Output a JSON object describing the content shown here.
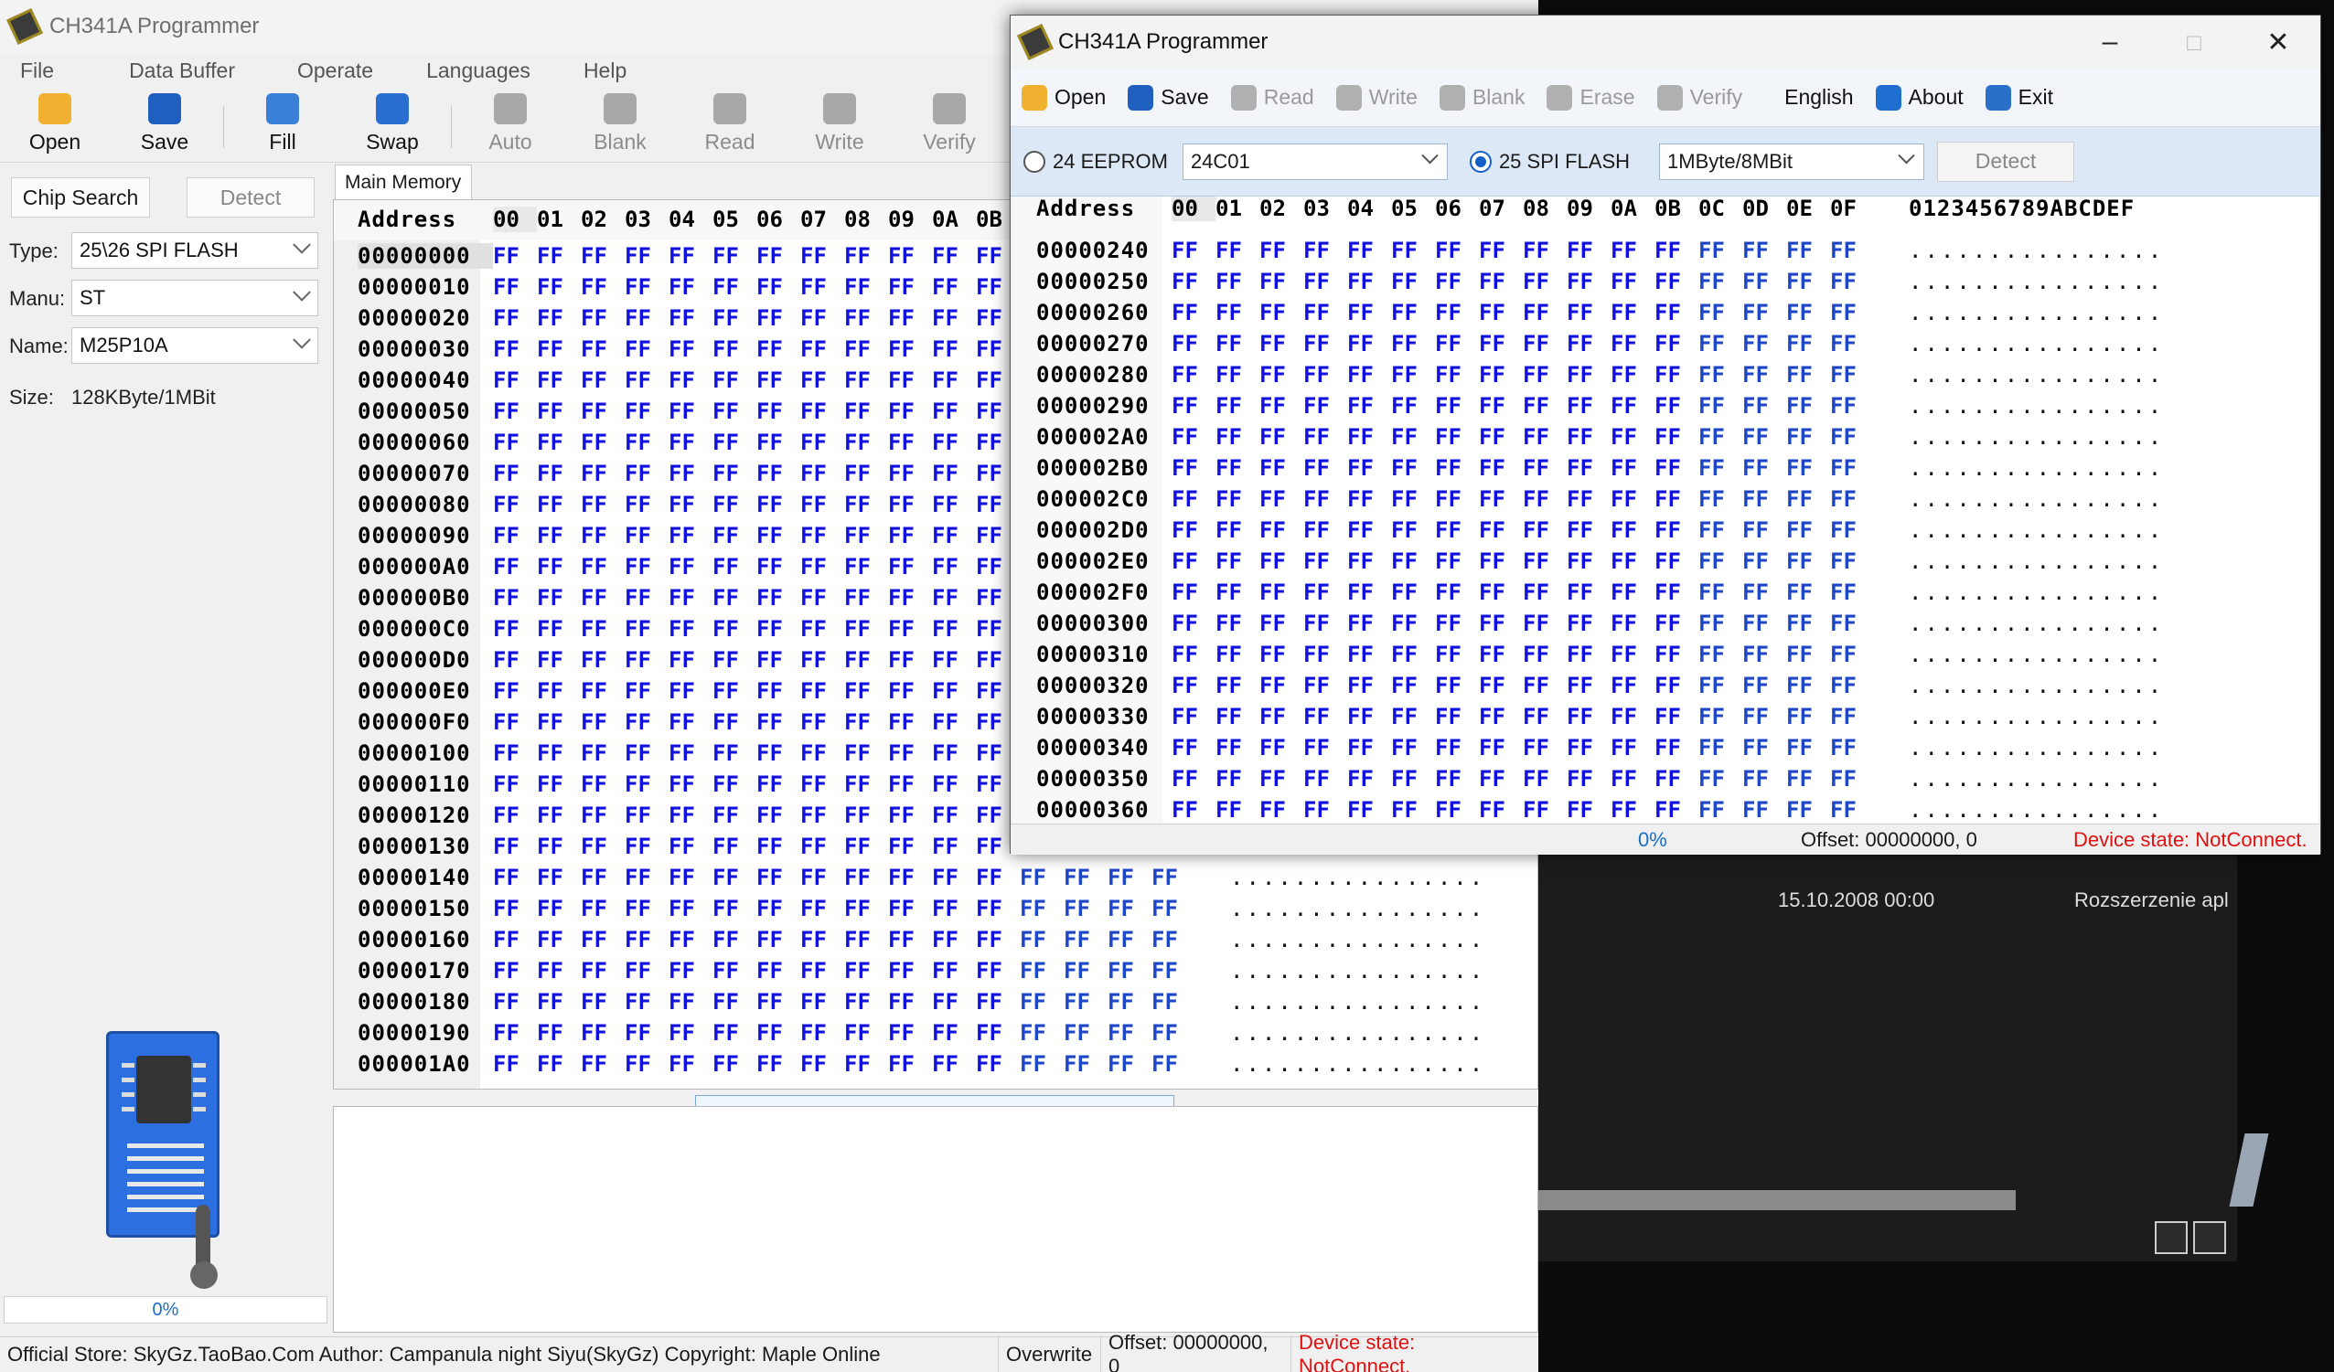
{
  "back_window": {
    "title": "CH341A Programmer",
    "menu": [
      "File",
      "Data Buffer",
      "Operate",
      "Languages",
      "Help"
    ],
    "toolbar": [
      {
        "label": "Open",
        "icon": "open-folder-icon",
        "enabled": true
      },
      {
        "label": "Save",
        "icon": "save-disk-icon",
        "enabled": true
      },
      {
        "label": "Fill",
        "icon": "fill-icon",
        "enabled": true
      },
      {
        "label": "Swap",
        "icon": "swap-arrows-icon",
        "enabled": true
      },
      {
        "label": "Auto",
        "icon": "auto-gear-icon",
        "enabled": false
      },
      {
        "label": "Blank",
        "icon": "blank-icon",
        "enabled": false
      },
      {
        "label": "Read",
        "icon": "read-icon",
        "enabled": false
      },
      {
        "label": "Write",
        "icon": "write-icon",
        "enabled": false
      },
      {
        "label": "Verify",
        "icon": "verify-icon",
        "enabled": false
      }
    ],
    "chip_search_label": "Chip Search",
    "detect_label": "Detect",
    "type_label": "Type:",
    "type_value": "25\\26 SPI FLASH",
    "manu_label": "Manu:",
    "manu_value": "ST",
    "name_label": "Name:",
    "name_value": "M25P10A",
    "size_label": "Size:",
    "size_value": "128KByte/1MBit",
    "progress": "0%",
    "tab_label": "Main Memory",
    "hex_header": {
      "address": "Address",
      "cols": [
        "00",
        "01",
        "02",
        "03",
        "04",
        "05",
        "06",
        "07",
        "08",
        "09",
        "0A",
        "0B",
        "0C",
        "0D",
        "0E",
        "0F"
      ]
    },
    "rows": [
      "00000000",
      "00000010",
      "00000020",
      "00000030",
      "00000040",
      "00000050",
      "00000060",
      "00000070",
      "00000080",
      "00000090",
      "000000A0",
      "000000B0",
      "000000C0",
      "000000D0",
      "000000E0",
      "000000F0",
      "00000100",
      "00000110",
      "00000120",
      "00000130",
      "00000140",
      "00000150",
      "00000160",
      "00000170",
      "00000180",
      "00000190",
      "000001A0"
    ],
    "cell_value": "FF",
    "ascii": "................",
    "status": {
      "store": "Official Store: SkyGz.TaoBao.Com Author: Campanula night Siyu(SkyGz) Copyright: Maple Online",
      "mode": "Overwrite",
      "offset": "Offset: 00000000, 0",
      "device": "Device state: NotConnect."
    }
  },
  "front_window": {
    "title": "CH341A Programmer",
    "toolbar": [
      {
        "label": "Open",
        "icon": "open-folder-icon",
        "enabled": true
      },
      {
        "label": "Save",
        "icon": "save-disk-icon",
        "enabled": true
      },
      {
        "label": "Read",
        "icon": "read-icon",
        "enabled": false
      },
      {
        "label": "Write",
        "icon": "write-icon",
        "enabled": false
      },
      {
        "label": "Blank",
        "icon": "blank-icon",
        "enabled": false
      },
      {
        "label": "Erase",
        "icon": "erase-icon",
        "enabled": false
      },
      {
        "label": "Verify",
        "icon": "verify-icon",
        "enabled": false
      },
      {
        "label": "English",
        "icon": "",
        "enabled": true
      },
      {
        "label": "About",
        "icon": "info-icon",
        "enabled": true
      },
      {
        "label": "Exit",
        "icon": "exit-door-icon",
        "enabled": true
      }
    ],
    "eeprom_label": "24 EEPROM",
    "eeprom_model": "24C01",
    "spi_label": "25 SPI FLASH",
    "spi_size": "1MByte/8MBit",
    "detect_label": "Detect",
    "hex_header": {
      "address": "Address",
      "cols": [
        "00",
        "01",
        "02",
        "03",
        "04",
        "05",
        "06",
        "07",
        "08",
        "09",
        "0A",
        "0B",
        "0C",
        "0D",
        "0E",
        "0F"
      ],
      "ascii": "0123456789ABCDEF"
    },
    "rows": [
      "00000240",
      "00000250",
      "00000260",
      "00000270",
      "00000280",
      "00000290",
      "000002A0",
      "000002B0",
      "000002C0",
      "000002D0",
      "000002E0",
      "000002F0",
      "00000300",
      "00000310",
      "00000320",
      "00000330",
      "00000340",
      "00000350",
      "00000360"
    ],
    "cell_value": "FF",
    "ascii": "................",
    "status": {
      "progress": "0%",
      "offset": "Offset: 00000000, 0",
      "device": "Device state: NotConnect."
    }
  },
  "background": {
    "date": "15.10.2008 00:00",
    "type": "Rozszerzenie apl"
  },
  "colors": {
    "hex": "#1010e0",
    "accent": "#1560c8",
    "error": "#e01010"
  }
}
